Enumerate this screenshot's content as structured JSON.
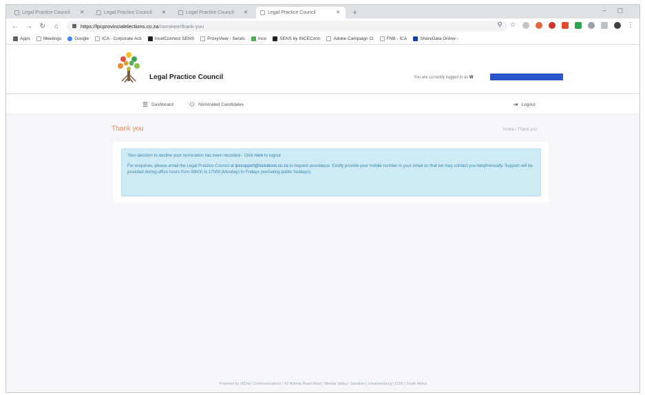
{
  "browser": {
    "tabs": [
      {
        "label": "Legal Practice Council",
        "active": false
      },
      {
        "label": "Legal Practice Council",
        "active": false
      },
      {
        "label": "Legal Practice Council",
        "active": false
      },
      {
        "label": "Legal Practice Council",
        "active": true
      }
    ],
    "new_tab": "+",
    "url_host": "https://lpcprovincialelections.co.za",
    "url_path": "/nominee/thank-you",
    "bookmarks": [
      {
        "label": "Apps",
        "color": "#5f6368"
      },
      {
        "label": "Meetings",
        "color": "#9aa0a6"
      },
      {
        "label": "Google",
        "color": "#4285f4"
      },
      {
        "label": "ICA - Corporate Acti",
        "color": "#9aa0a6"
      },
      {
        "label": "IncelConnect SENS",
        "color": "#202124"
      },
      {
        "label": "ProxyView - Sends",
        "color": "#9aa0a6"
      },
      {
        "label": "Ince",
        "color": "#4caf50"
      },
      {
        "label": "SENS by INCEConn",
        "color": "#202124"
      },
      {
        "label": "Adobe Campaign Cl",
        "color": "#9aa0a6"
      },
      {
        "label": "FNB - ICA",
        "color": "#9aa0a6"
      },
      {
        "label": "ShareData Online -",
        "color": "#1a3fa8"
      }
    ]
  },
  "site": {
    "title": "Legal Practice Council",
    "logged_in_text": "You are currently logged in as",
    "logged_in_initial": "W",
    "nav": {
      "dashboard": "Dashboard",
      "nominated_candidates": "Nominated Candidates",
      "logout": "Logout"
    }
  },
  "main": {
    "page_title": "Thank you",
    "breadcrumb": {
      "home": "Home",
      "separator": "/",
      "current": "Thank you"
    },
    "alert": {
      "line1_text": "Your decision to decline your nomination has been recorded - Click ",
      "line1_link": "here",
      "line1_tail": " to logout",
      "para2_text": "For enquiries, please email the Legal Practice Council at ",
      "para2_email": "lpcsupport@lsolutions.co.za",
      "para2_tail": " to request assistance. Kindly provide your mobile number in your email so that we may contact you telephonically. Support will be provided during office hours from 08h00 to 17h00 (Monday) to Fridays (excluding public holidays)."
    }
  },
  "footer": {
    "text": "Powered by (4One) Communications | 42 Wierda Road West | Wierda Valley | Sandton | Johannesburg | 2196 | South Africa"
  }
}
